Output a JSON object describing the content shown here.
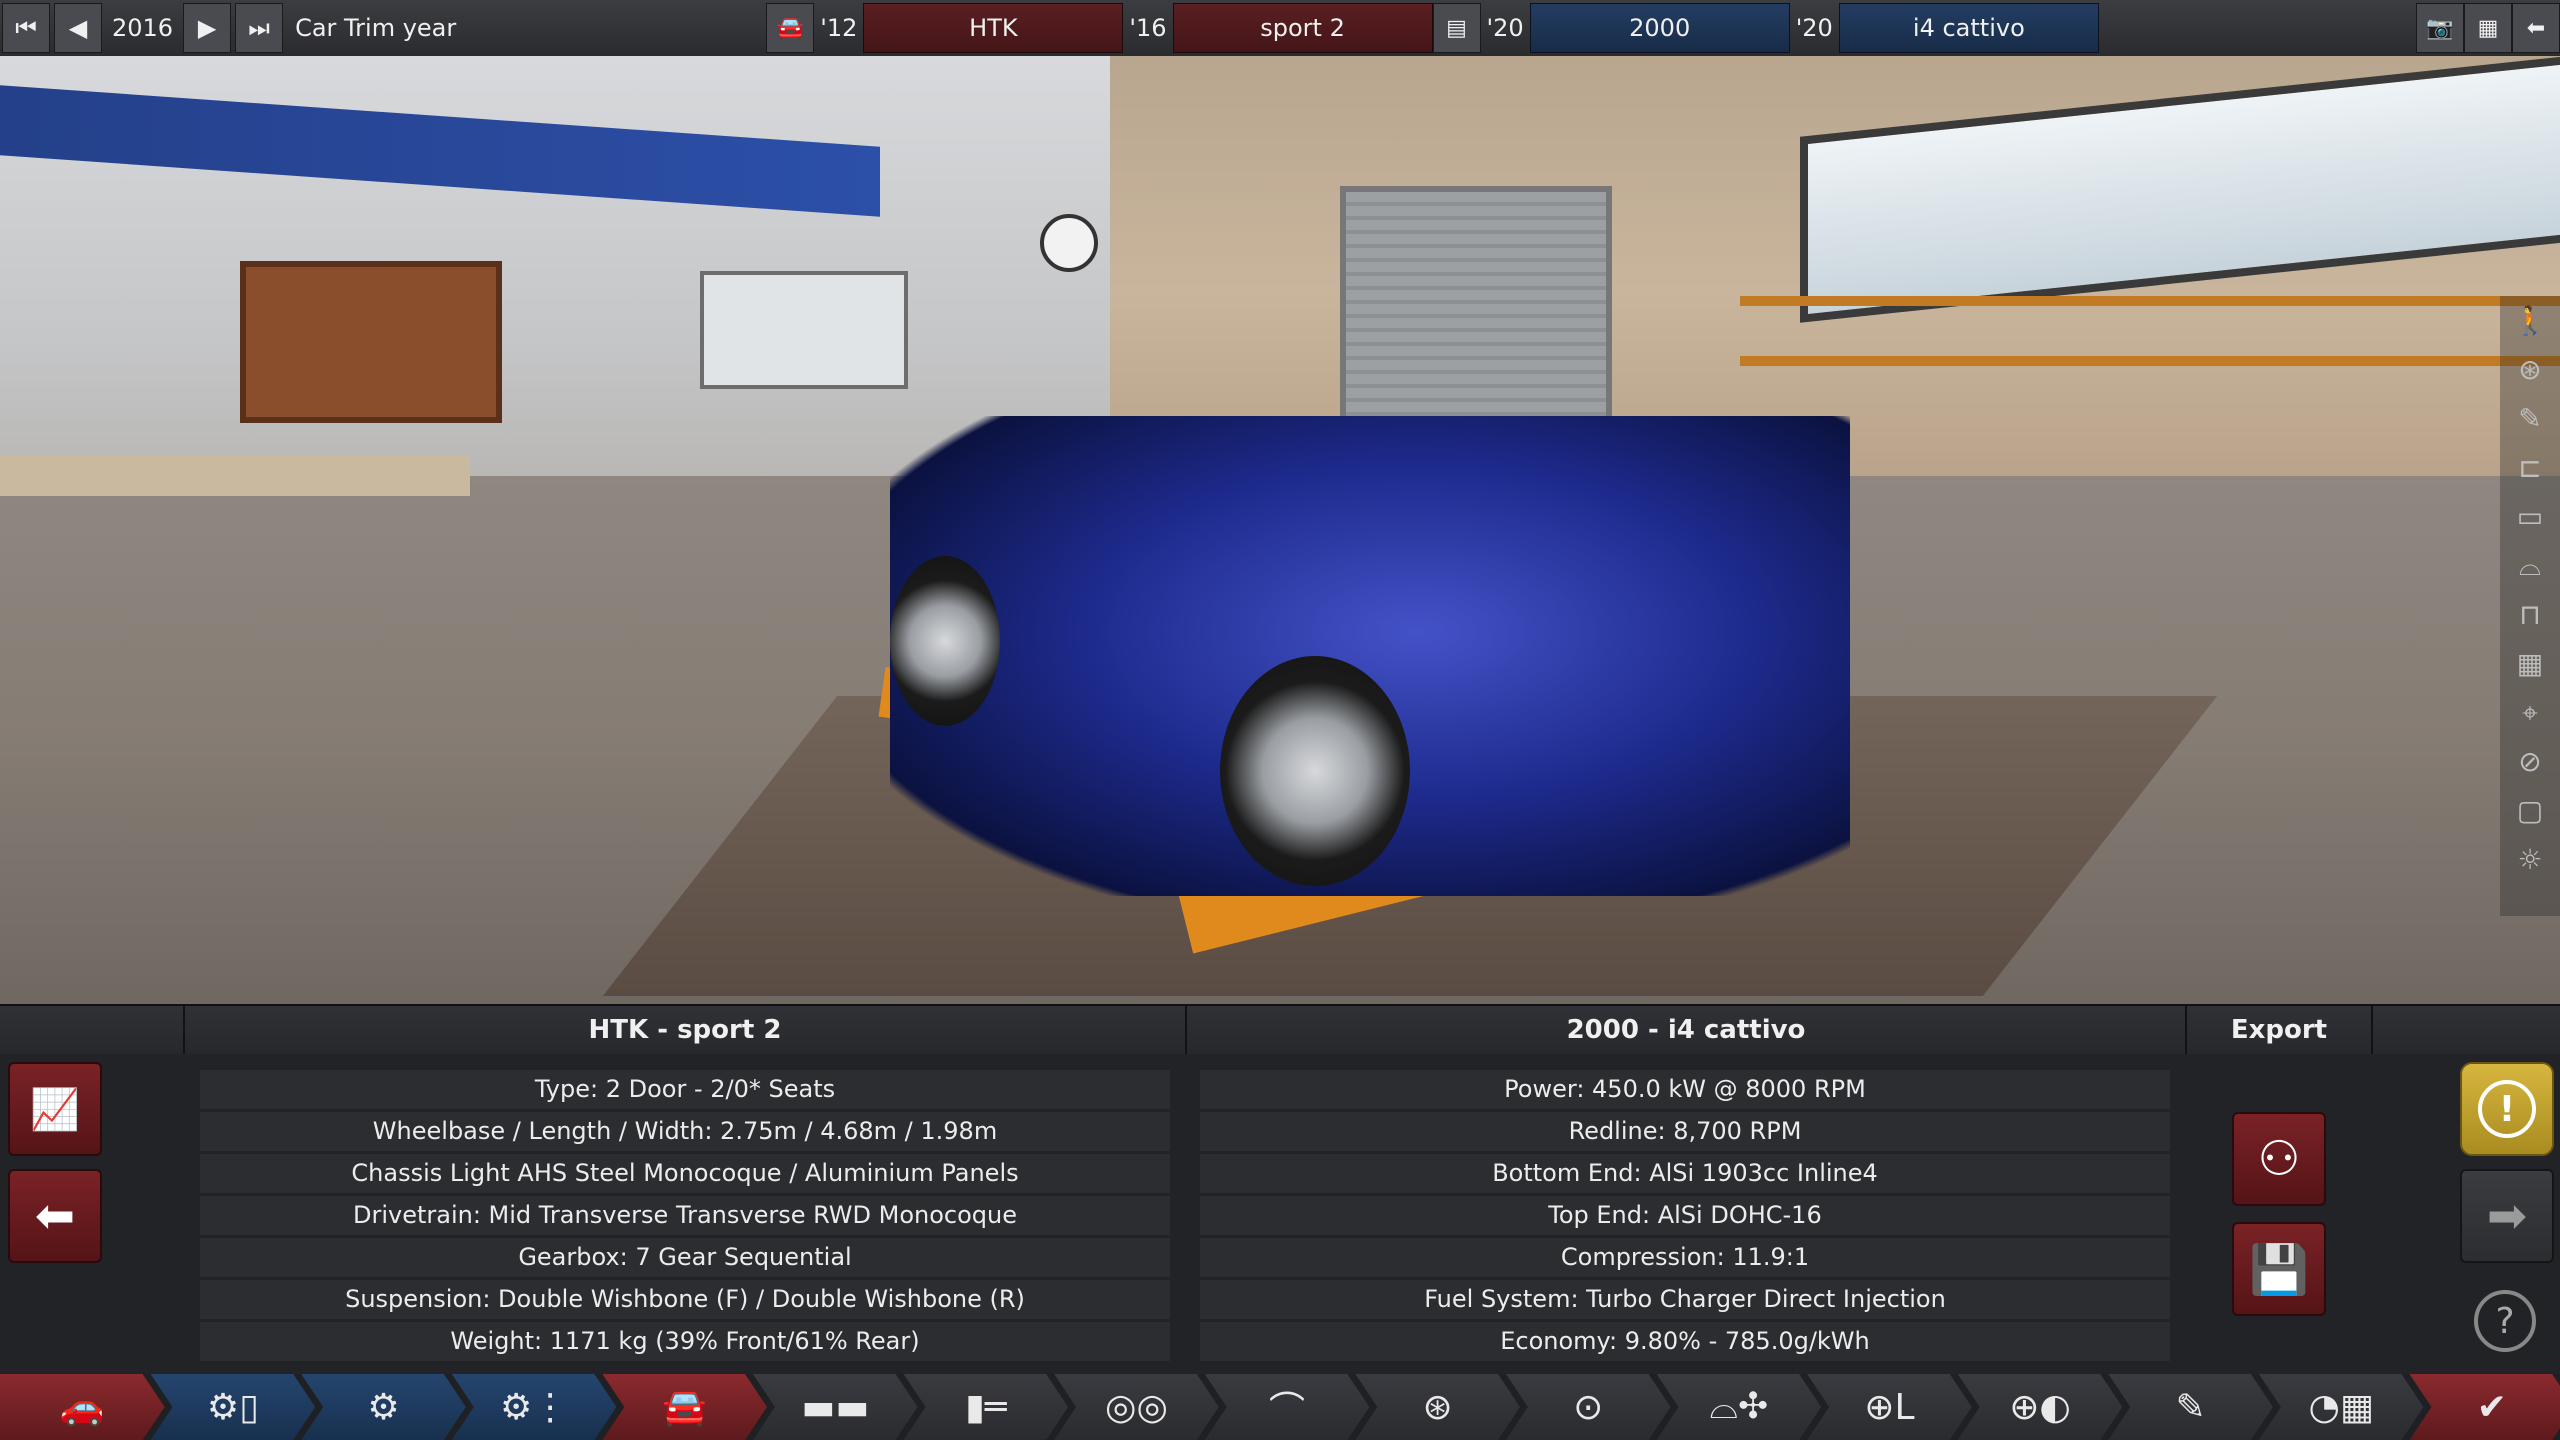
{
  "topbar": {
    "year": "2016",
    "year_label": "Car Trim year",
    "model_year": "'12",
    "model_name": "HTK",
    "trim_year": "'16",
    "trim_name": "sport 2",
    "engine_family_year": "'20",
    "engine_family_name": "2000",
    "engine_variant_year": "'20",
    "engine_variant_name": "i4 cattivo"
  },
  "panel": {
    "car_title": "HTK - sport 2",
    "engine_title": "2000 - i4 cattivo",
    "export_title": "Export",
    "car_rows": [
      "Type: 2 Door - 2/0* Seats",
      "Wheelbase / Length / Width: 2.75m / 4.68m / 1.98m",
      "Chassis Light AHS Steel Monocoque / Aluminium Panels",
      "Drivetrain: Mid Transverse Transverse RWD Monocoque",
      "Gearbox: 7 Gear Sequential",
      "Suspension: Double Wishbone (F) / Double Wishbone (R)",
      "Weight: 1171 kg (39% Front/61% Rear)"
    ],
    "engine_rows": [
      "Power: 450.0 kW @ 8000 RPM",
      "Redline:  8,700 RPM",
      "Bottom End: AlSi 1903cc Inline4",
      "Top End: AlSi DOHC-16",
      "Compression: 11.9:1",
      "Fuel System: Turbo Charger Direct Injection",
      "Economy: 9.80% - 785.0g/kWh"
    ]
  },
  "icons": {
    "rewind": "⏮",
    "prev": "◀",
    "next": "▶",
    "fast_forward": "⏭",
    "car": "🚘",
    "engine": "▤",
    "camera": "📷",
    "calculator": "▦",
    "back": "⬅",
    "chart": "📈",
    "share": "⚇",
    "save": "💾",
    "warning": "!",
    "arrow_right": "➡",
    "help": "?",
    "check": "✔"
  },
  "colors": {
    "red_accent": "#7a2226",
    "blue_accent": "#233d62",
    "gold_accent": "#d6b63e"
  }
}
